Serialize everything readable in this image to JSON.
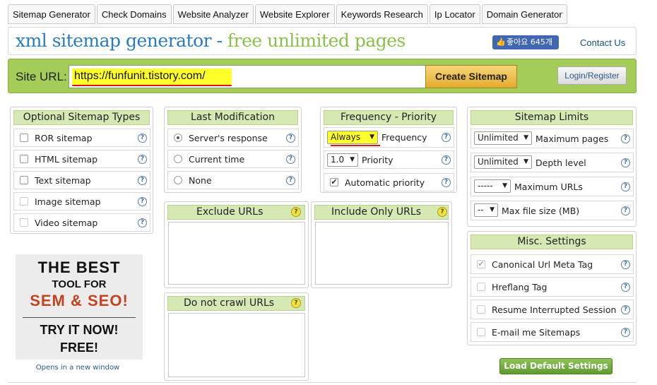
{
  "tabs": [
    "Sitemap Generator",
    "Check Domains",
    "Website Analyzer",
    "Website Explorer",
    "Keywords Research",
    "Ip Locator",
    "Domain Generator"
  ],
  "header": {
    "title_part1": "xml sitemap generator",
    "title_sep": " - ",
    "title_part2": "free unlimited pages",
    "fb_label": "좋아요 645개",
    "contact": "Contact Us"
  },
  "url_bar": {
    "label": "Site URL:",
    "value": "https://funfunit.tistory.com/",
    "create_button": "Create Sitemap",
    "login_button": "Login/Register"
  },
  "optional_types": {
    "heading": "Optional Sitemap Types",
    "items": [
      {
        "label": "ROR sitemap",
        "checked": false,
        "enabled": true
      },
      {
        "label": "HTML sitemap",
        "checked": false,
        "enabled": true
      },
      {
        "label": "Text sitemap",
        "checked": false,
        "enabled": true
      },
      {
        "label": "Image sitemap",
        "checked": false,
        "enabled": false
      },
      {
        "label": "Video sitemap",
        "checked": false,
        "enabled": false
      }
    ]
  },
  "last_modification": {
    "heading": "Last Modification",
    "options": [
      {
        "label": "Server's response",
        "selected": true
      },
      {
        "label": "Current time",
        "selected": false
      },
      {
        "label": "None",
        "selected": false
      }
    ]
  },
  "frequency_priority": {
    "heading": "Frequency - Priority",
    "frequency_value": "Always",
    "frequency_label": "Frequency",
    "priority_value": "1.0",
    "priority_label": "Priority",
    "auto_priority_label": "Automatic priority",
    "auto_priority_checked": true
  },
  "sitemap_limits": {
    "heading": "Sitemap Limits",
    "rows": [
      {
        "value": "Unlimited",
        "label": "Maximum pages"
      },
      {
        "value": "Unlimited",
        "label": "Depth level"
      },
      {
        "value": "-----",
        "label": "Maximum URLs"
      },
      {
        "value": "--",
        "label": "Max file size (MB)"
      }
    ]
  },
  "exclude_urls": {
    "heading": "Exclude URLs"
  },
  "include_only_urls": {
    "heading": "Include Only URLs"
  },
  "do_not_crawl": {
    "heading": "Do not crawl URLs"
  },
  "misc_settings": {
    "heading": "Misc. Settings",
    "items": [
      {
        "label": "Canonical Url Meta Tag",
        "checked": true,
        "enabled": false
      },
      {
        "label": "Hreflang Tag",
        "checked": false,
        "enabled": false
      },
      {
        "label": "Resume Interrupted Session",
        "checked": false,
        "enabled": false
      },
      {
        "label": "E-mail me Sitemaps",
        "checked": false,
        "enabled": false
      }
    ]
  },
  "promo": {
    "line1": "THE BEST",
    "line2": "TOOL FOR",
    "line3": "SEM & SEO!",
    "line4": "TRY IT NOW!",
    "line5": "FREE!",
    "caption": "Opens in a new window"
  },
  "load_defaults_button": "Load Default Settings",
  "help_glyph": "?",
  "colors": {
    "accent_green": "#a3cd58",
    "title_blue": "#2a7bbd",
    "title_green": "#8ac04a",
    "highlight": "#ffff29"
  }
}
